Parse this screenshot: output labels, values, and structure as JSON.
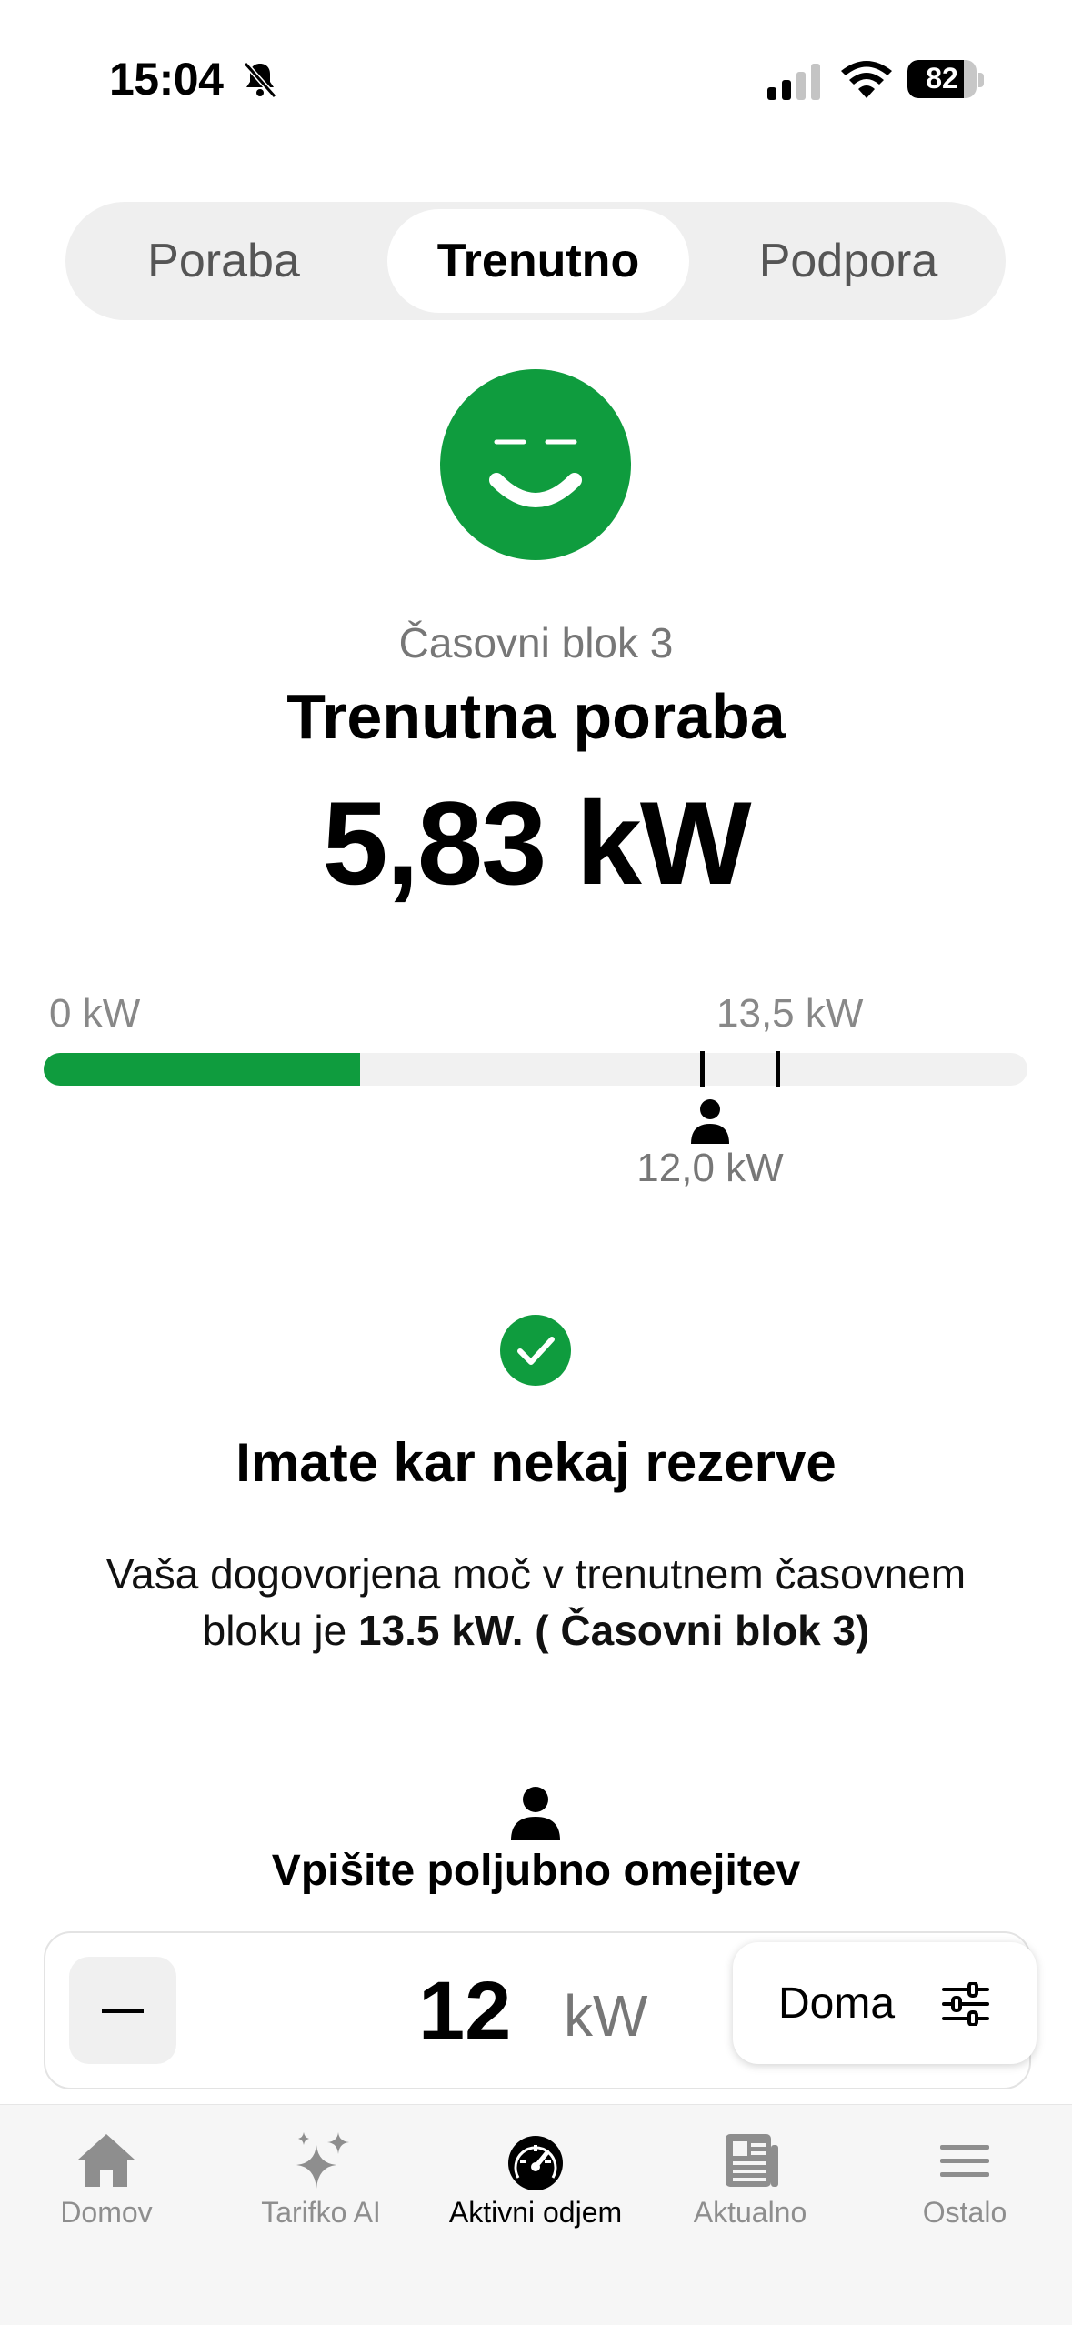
{
  "status": {
    "time": "15:04",
    "battery": "82",
    "battery_level": 0.82
  },
  "segments": [
    "Poraba",
    "Trenutno",
    "Podpora"
  ],
  "block_label": "Časovni blok 3",
  "title": "Trenutna poraba",
  "current_value": "5,83 kW",
  "gauge": {
    "min_label": "0 kW",
    "max_label": "13,5 kW",
    "marker_label": "12,0 kW",
    "current_kw": 5.83,
    "limit_kw": 13.5,
    "user_kw": 12.0
  },
  "reserve_title": "Imate kar nekaj rezerve",
  "description": {
    "text": "Vaša dogovorjena moč v trenutnem časovnem bloku je ",
    "bold": "13.5 kW. ( Časovni blok 3)"
  },
  "enter_label": "Vpišite poljubno omejitev",
  "stepper": {
    "value": "12",
    "unit": "kW"
  },
  "profile_button": "Doma",
  "tabs": [
    "Domov",
    "Tarifko AI",
    "Aktivni odjem",
    "Aktualno",
    "Ostalo"
  ],
  "colors": {
    "accent": "#0f9c3e",
    "track": "#f1f1f1"
  },
  "icons": [
    "bell-slash-icon",
    "signal-icon",
    "wifi-icon",
    "battery-icon",
    "smiley-icon",
    "person-icon",
    "check-icon",
    "minus-icon",
    "sliders-icon",
    "home-icon",
    "sparkles-icon",
    "speedometer-icon",
    "newspaper-icon",
    "menu-icon"
  ]
}
